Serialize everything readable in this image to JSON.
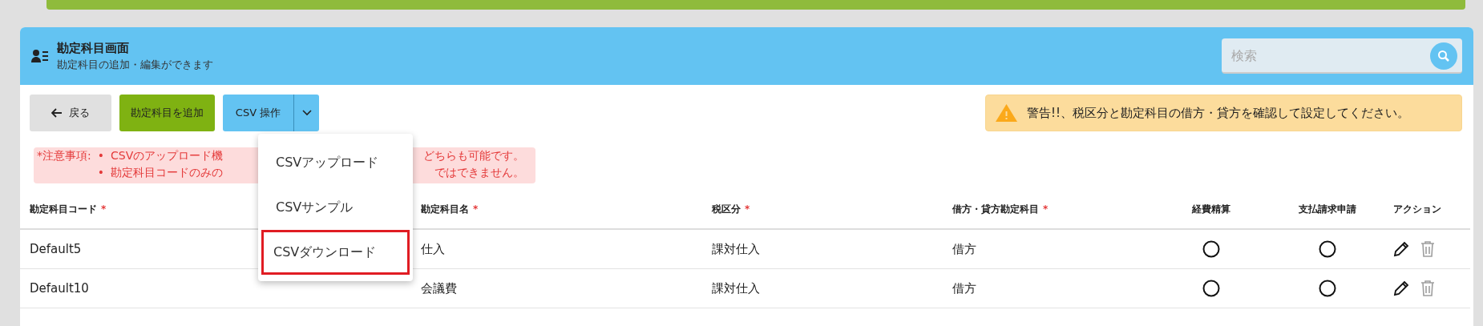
{
  "header": {
    "title": "勘定科目画面",
    "subtitle": "勘定科目の追加・編集ができます",
    "search": {
      "placeholder": "検索"
    }
  },
  "toolbar": {
    "back": "戻る",
    "add": "勘定科目を追加",
    "csv": "CSV 操作"
  },
  "csv_menu": {
    "open": true,
    "items": [
      {
        "label": "CSVアップロード",
        "highlighted": false
      },
      {
        "label": "CSVサンプル",
        "highlighted": false
      },
      {
        "label": "CSVダウンロード",
        "highlighted": true
      }
    ]
  },
  "warning": "警告!!、税区分と勘定科目の借方・貸方を確認して設定してください。",
  "notice": {
    "label": "*注意事項:",
    "bullet": "•",
    "items": [
      {
        "start": "CSVのアップロード機",
        "end": "どちらも可能です。"
      },
      {
        "start": "勘定科目コードのみの",
        "end": "ではできません。"
      }
    ]
  },
  "table": {
    "columns": [
      {
        "label": "勘定科目コード",
        "required": true
      },
      {
        "label": "勘定科目名",
        "required": true
      },
      {
        "label": "税区分",
        "required": true
      },
      {
        "label": "借方・貸方勘定科目",
        "required": true
      },
      {
        "label": "経費精算",
        "required": false
      },
      {
        "label": "支払請求申請",
        "required": false
      },
      {
        "label": "アクション",
        "required": false
      }
    ],
    "required_mark": "*",
    "rows": [
      {
        "code": "Default5",
        "name": "仕入",
        "tax": "課対仕入",
        "side": "借方",
        "expense": true,
        "payment": true,
        "delete_disabled": true
      },
      {
        "code": "Default10",
        "name": "会議費",
        "tax": "課対仕入",
        "side": "借方",
        "expense": true,
        "payment": true,
        "delete_disabled": true
      }
    ]
  }
}
